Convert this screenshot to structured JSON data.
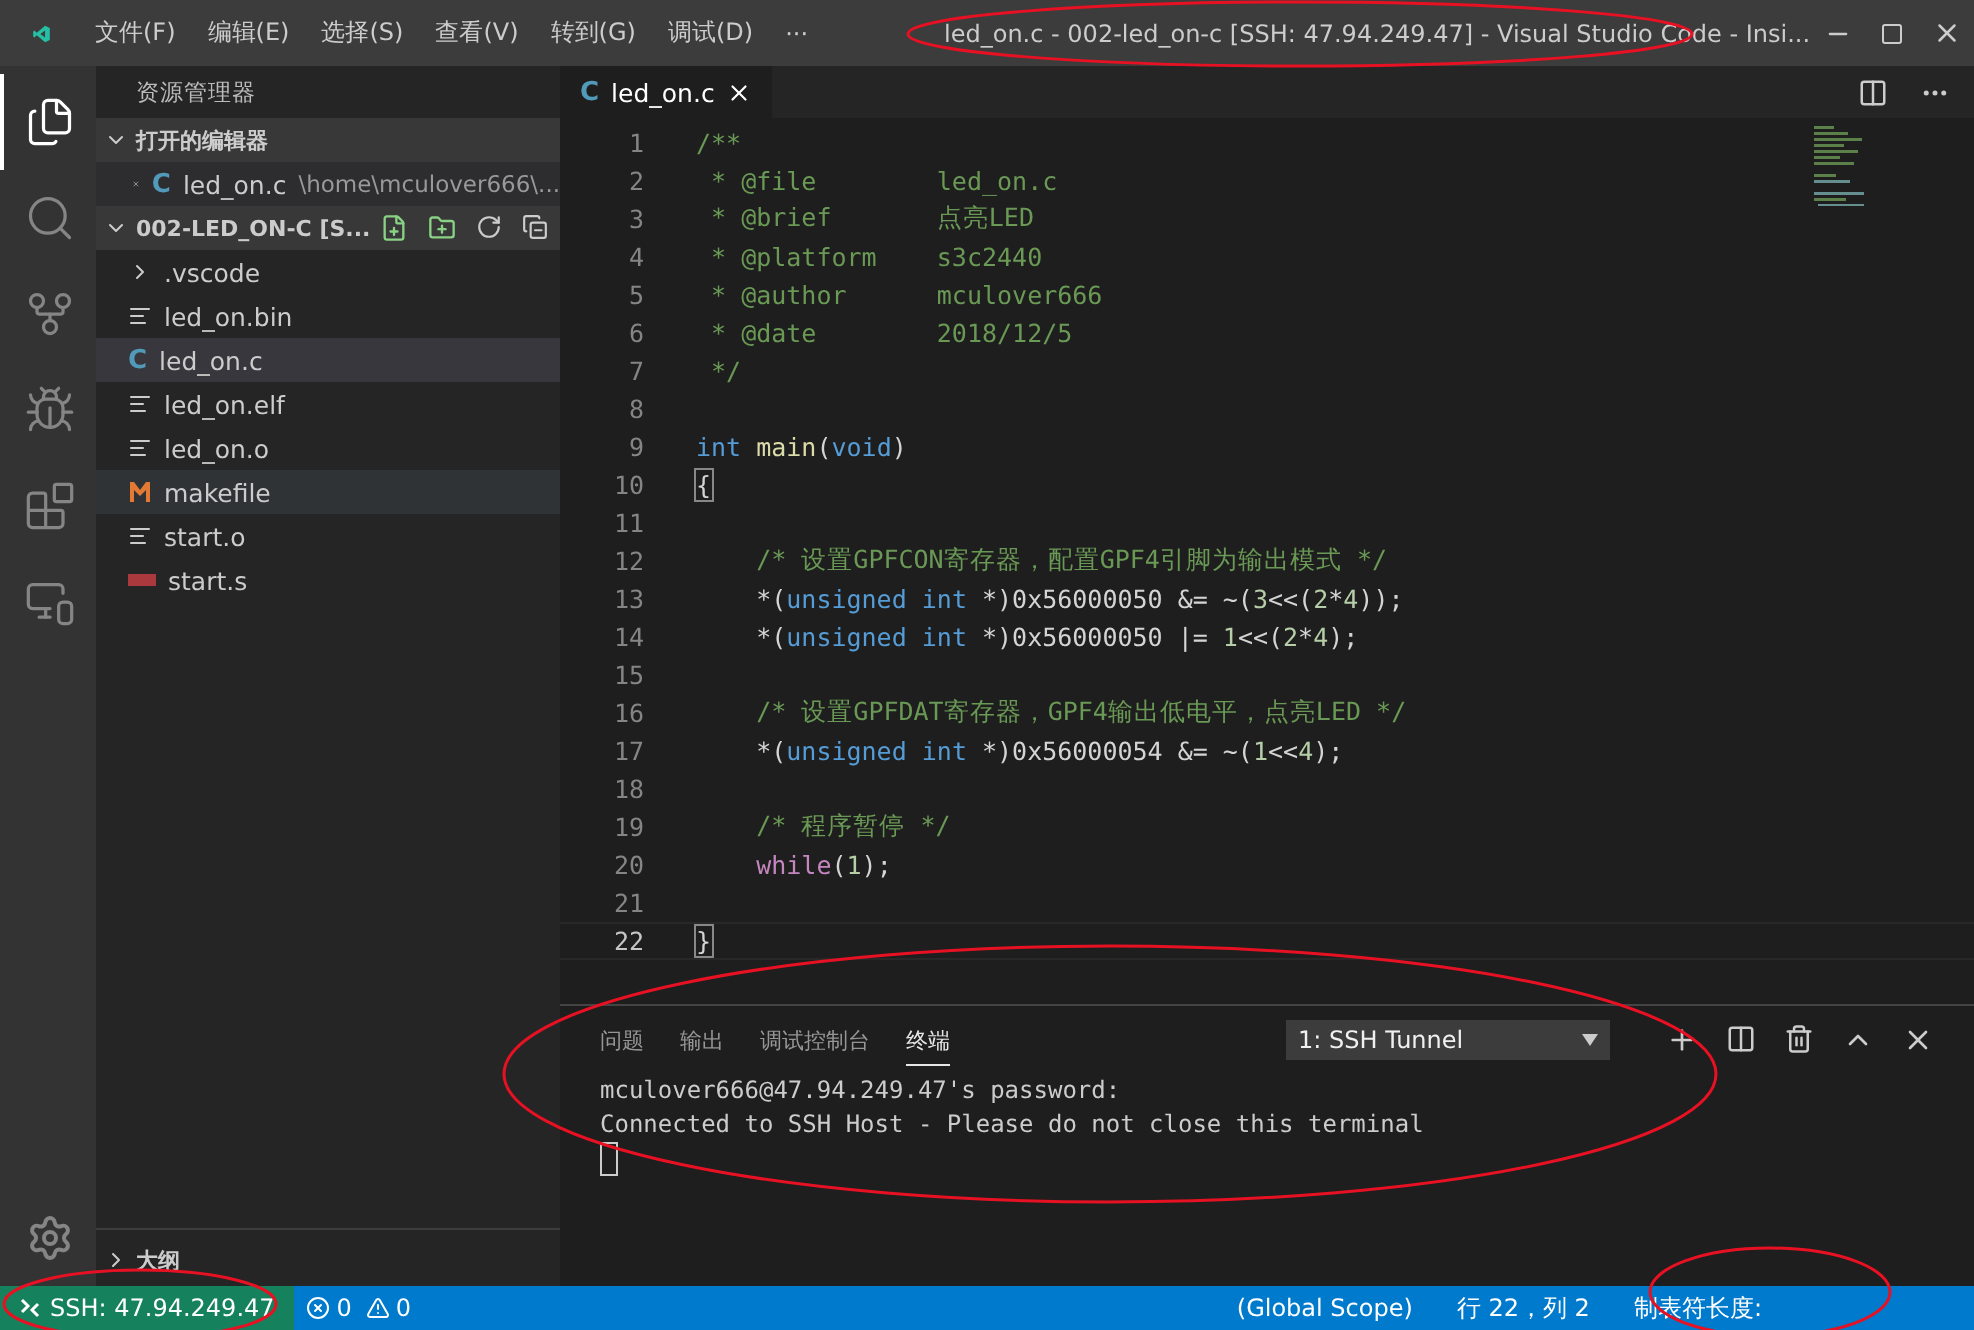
{
  "title_bar": {
    "menus": [
      "文件(F)",
      "编辑(E)",
      "选择(S)",
      "查看(V)",
      "转到(G)",
      "调试(D)"
    ],
    "more": "···",
    "title": "led_on.c - 002-led_on-c [SSH: 47.94.249.47] - Visual Studio Code - Insi..."
  },
  "activity_bar": {
    "items": [
      {
        "kind": "files",
        "selected": true
      },
      {
        "kind": "search",
        "selected": false
      },
      {
        "kind": "git",
        "selected": false
      },
      {
        "kind": "debug",
        "selected": false
      },
      {
        "kind": "extensions",
        "selected": false
      },
      {
        "kind": "remote",
        "selected": false
      }
    ]
  },
  "sidebar": {
    "title": "资源管理器",
    "open_editors": {
      "label": "打开的编辑器",
      "expanded": true,
      "items": [
        {
          "name": "led_on.c",
          "path": "\\home\\mculover666\\...",
          "kind": "c",
          "letter": "C"
        }
      ]
    },
    "folder": {
      "label": "002-LED_ON-C [S...",
      "expanded": true,
      "items": [
        {
          "name": ".vscode",
          "kind": "folder",
          "selected": false,
          "hovered": false
        },
        {
          "name": "led_on.bin",
          "kind": "lines",
          "selected": false,
          "hovered": false
        },
        {
          "name": "led_on.c",
          "kind": "c",
          "letter": "C",
          "selected": true,
          "hovered": false
        },
        {
          "name": "led_on.elf",
          "kind": "lines",
          "selected": false,
          "hovered": false
        },
        {
          "name": "led_on.o",
          "kind": "lines",
          "selected": false,
          "hovered": false
        },
        {
          "name": "makefile",
          "kind": "m",
          "selected": false,
          "hovered": true
        },
        {
          "name": "start.o",
          "kind": "lines",
          "selected": false,
          "hovered": false
        },
        {
          "name": "start.s",
          "kind": "asm",
          "selected": false,
          "hovered": false
        }
      ]
    },
    "outline": {
      "label": "大纲",
      "expanded": false
    }
  },
  "editor": {
    "tabs": [
      {
        "name": "led_on.c",
        "kind": "c",
        "letter": "C",
        "selected": true
      }
    ],
    "lines": [
      {
        "number": "1",
        "current": false,
        "tokens": [
          {
            "kind": "comment",
            "t": "/**"
          }
        ]
      },
      {
        "number": "2",
        "current": false,
        "tokens": [
          {
            "kind": "comment",
            "t": " * @file        led_on.c"
          }
        ]
      },
      {
        "number": "3",
        "current": false,
        "tokens": [
          {
            "kind": "comment",
            "t": " * @brief       点亮LED"
          }
        ]
      },
      {
        "number": "4",
        "current": false,
        "tokens": [
          {
            "kind": "comment",
            "t": " * @platform    s3c2440"
          }
        ]
      },
      {
        "number": "5",
        "current": false,
        "tokens": [
          {
            "kind": "comment",
            "t": " * @author      mculover666"
          }
        ]
      },
      {
        "number": "6",
        "current": false,
        "tokens": [
          {
            "kind": "comment",
            "t": " * @date        2018/12/5"
          }
        ]
      },
      {
        "number": "7",
        "current": false,
        "tokens": [
          {
            "kind": "comment",
            "t": " */"
          }
        ]
      },
      {
        "number": "8",
        "current": false
      },
      {
        "number": "9",
        "current": false,
        "tokens": [
          {
            "kind": "keyword",
            "t": "int"
          },
          {
            "kind": "fn",
            "t": " main"
          },
          {
            "kind": "plain",
            "t": "("
          },
          {
            "kind": "keyword",
            "t": "void"
          },
          {
            "kind": "plain",
            "t": ")"
          }
        ]
      },
      {
        "number": "10",
        "current": false,
        "tokens": [
          {
            "kind": "bracket",
            "t": "{"
          }
        ]
      },
      {
        "number": "11",
        "current": false
      },
      {
        "number": "12",
        "current": false,
        "tokens": [
          {
            "kind": "comment",
            "t": "    /* 设置GPFCON寄存器，配置GPF4引脚为输出模式 */"
          }
        ]
      },
      {
        "number": "13",
        "current": false,
        "tokens": [
          {
            "kind": "plain",
            "t": "    *("
          },
          {
            "kind": "keyword",
            "t": "unsigned int"
          },
          {
            "kind": "plain",
            "t": " *)0x56000050 &= ~("
          },
          {
            "kind": "num",
            "t": "3"
          },
          {
            "kind": "plain",
            "t": "<<("
          },
          {
            "kind": "num",
            "t": "2"
          },
          {
            "kind": "plain",
            "t": "*"
          },
          {
            "kind": "num",
            "t": "4"
          },
          {
            "kind": "plain",
            "t": "));"
          }
        ]
      },
      {
        "number": "14",
        "current": false,
        "tokens": [
          {
            "kind": "plain",
            "t": "    *("
          },
          {
            "kind": "keyword",
            "t": "unsigned int"
          },
          {
            "kind": "plain",
            "t": " *)0x56000050 |= "
          },
          {
            "kind": "num",
            "t": "1"
          },
          {
            "kind": "plain",
            "t": "<<("
          },
          {
            "kind": "num",
            "t": "2"
          },
          {
            "kind": "plain",
            "t": "*"
          },
          {
            "kind": "num",
            "t": "4"
          },
          {
            "kind": "plain",
            "t": ");"
          }
        ]
      },
      {
        "number": "15",
        "current": false
      },
      {
        "number": "16",
        "current": false,
        "tokens": [
          {
            "kind": "comment",
            "t": "    /* 设置GPFDAT寄存器，GPF4输出低电平，点亮LED */"
          }
        ]
      },
      {
        "number": "17",
        "current": false,
        "tokens": [
          {
            "kind": "plain",
            "t": "    *("
          },
          {
            "kind": "keyword",
            "t": "unsigned int"
          },
          {
            "kind": "plain",
            "t": " *)0x56000054 &= ~("
          },
          {
            "kind": "num",
            "t": "1"
          },
          {
            "kind": "plain",
            "t": "<<"
          },
          {
            "kind": "num",
            "t": "4"
          },
          {
            "kind": "plain",
            "t": ");"
          }
        ]
      },
      {
        "number": "18",
        "current": false
      },
      {
        "number": "19",
        "current": false,
        "tokens": [
          {
            "kind": "comment",
            "t": "    /* 程序暂停 */"
          }
        ]
      },
      {
        "number": "20",
        "current": false,
        "tokens": [
          {
            "kind": "control",
            "t": "    while"
          },
          {
            "kind": "plain",
            "t": "("
          },
          {
            "kind": "num",
            "t": "1"
          },
          {
            "kind": "plain",
            "t": ");"
          }
        ]
      },
      {
        "number": "21",
        "current": false
      },
      {
        "number": "22",
        "current": true,
        "tokens": [
          {
            "kind": "bracket",
            "t": "}"
          }
        ]
      }
    ]
  },
  "panel": {
    "tabs": [
      {
        "label": "问题",
        "selected": false
      },
      {
        "label": "输出",
        "selected": false
      },
      {
        "label": "调试控制台",
        "selected": false
      },
      {
        "label": "终端",
        "selected": true
      }
    ],
    "terminal_select": "1: SSH Tunnel",
    "terminal_lines": [
      "mculover666@47.94.249.47's password:",
      "Connected to SSH Host - Please do not close this terminal"
    ]
  },
  "status_bar": {
    "remote": "SSH: 47.94.249.47",
    "errors": "0",
    "warnings": "0",
    "right": [
      "(Global Scope)",
      "行 22，列 2",
      "制表符长度:"
    ]
  }
}
